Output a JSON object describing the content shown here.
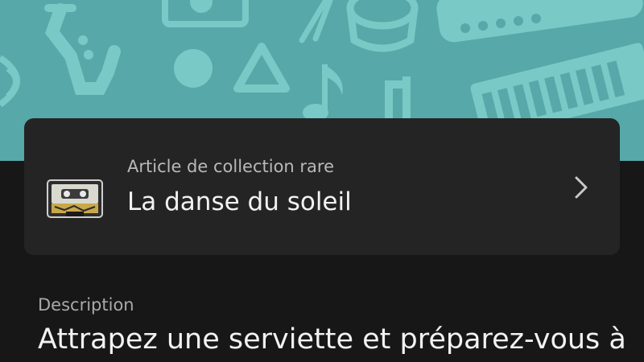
{
  "banner": {
    "background_color": "#57a8a9",
    "pattern_color": "#79c9c6",
    "icons": [
      "saxophone-icon",
      "drum-icon",
      "triangle-icon",
      "music-note-icon",
      "keyboard-icon",
      "flute-icon",
      "drumsticks-icon",
      "speaker-icon"
    ]
  },
  "collectible": {
    "icon": "cassette-icon",
    "subtitle": "Article de collection rare",
    "title": "La danse du soleil",
    "chevron_icon": "chevron-right-icon"
  },
  "description": {
    "label": "Description",
    "text": "Attrapez une serviette et préparez-vous à"
  },
  "colors": {
    "page_background": "#171717",
    "card_background": "#242424",
    "title_text": "#f2f2f2",
    "secondary_text": "#b9b9b9"
  }
}
